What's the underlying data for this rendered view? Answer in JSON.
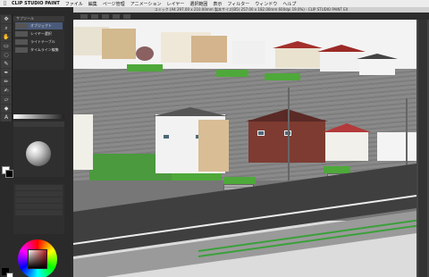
{
  "menubar": {
    "apple": "",
    "app_name": "CLIP STUDIO PAINT",
    "items": [
      "ファイル",
      "編集",
      "ページ管理",
      "アニメーション",
      "レイヤー",
      "選択範囲",
      "表示",
      "フィルター",
      "ウィンドウ",
      "ヘルプ"
    ]
  },
  "document": {
    "title": "コミック (A4 297.00 x 210.00mm 製本サイズ(B5) 257.00 x 182.00mm 600dpi 19.0%) - CLIP STUDIO PAINT EX"
  },
  "subtool": {
    "header": "サブツール",
    "items": [
      "オブジェクト",
      "レイヤー選択",
      "ライトテーブル",
      "タイムライン編集"
    ]
  },
  "colors": {
    "accent": "#4a5a7a",
    "foreground": "#ffffff",
    "background": "#000000"
  },
  "icons": [
    "move-icon",
    "zoom-icon",
    "hand-icon",
    "select-icon",
    "lasso-icon",
    "eyedropper-icon",
    "pen-icon",
    "pencil-icon",
    "brush-icon",
    "airbrush-icon",
    "eraser-icon",
    "fill-icon",
    "gradient-icon",
    "figure-icon",
    "text-icon",
    "balloon-icon"
  ]
}
